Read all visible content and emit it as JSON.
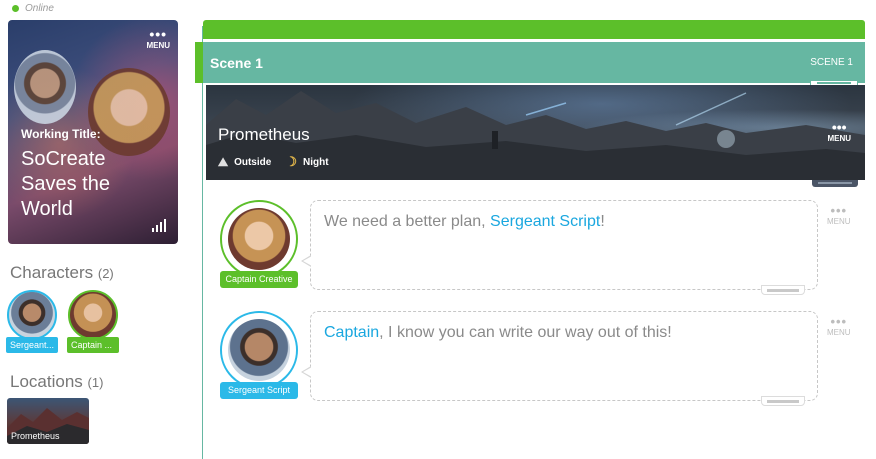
{
  "status": {
    "label": "Online",
    "color": "#5cbf2a"
  },
  "story": {
    "working_title_label": "Working Title:",
    "title": "SoCreate Saves the World",
    "menu_label": "MENU"
  },
  "characters": {
    "heading": "Characters",
    "count": "(2)",
    "items": [
      {
        "name": "Sergeant Script",
        "short": "Sergeant...",
        "color": "#2bb9e8"
      },
      {
        "name": "Captain Creative",
        "short": "Captain ...",
        "color": "#5cbf2a"
      }
    ]
  },
  "locations": {
    "heading": "Locations",
    "count": "(1)",
    "items": [
      {
        "name": "Prometheus"
      }
    ]
  },
  "scene": {
    "name": "Scene 1",
    "number_label": "SCENE 1",
    "accent": "#66b7a2"
  },
  "location_banner": {
    "name": "Prometheus",
    "setting": "Outside",
    "time": "Night",
    "menu_label": "MENU"
  },
  "dialogue": [
    {
      "character": "Captain Creative",
      "color": "#5cbf2a",
      "text_before": "We need a better plan, ",
      "highlight": "Sergeant Script",
      "text_after": "!",
      "menu_label": "MENU"
    },
    {
      "character": "Sergeant Script",
      "color": "#2bb9e8",
      "highlight": "Captain",
      "text_after": ", I know you can write our way out of this!",
      "menu_label": "MENU"
    }
  ]
}
